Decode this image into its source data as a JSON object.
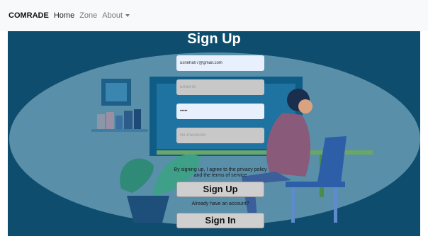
{
  "navbar": {
    "brand": "COMRADE",
    "links": [
      "Home",
      "Zone",
      "About"
    ]
  },
  "form": {
    "title": "Sign Up",
    "username_value": "usneha07@gmail.com",
    "email_placeholder": "Email-Id",
    "password_value": "•••••",
    "repassword_placeholder": "Re-Password",
    "terms_line1": "By signing up, I agree to the privacy policy",
    "terms_line2": "and the terms of service",
    "signup_label": "Sign Up",
    "already_text": "Already have an account?",
    "signin_label": "Sign In"
  },
  "colors": {
    "hero_bg": "#0e4d6e",
    "ellipse": "#5a8faa"
  }
}
